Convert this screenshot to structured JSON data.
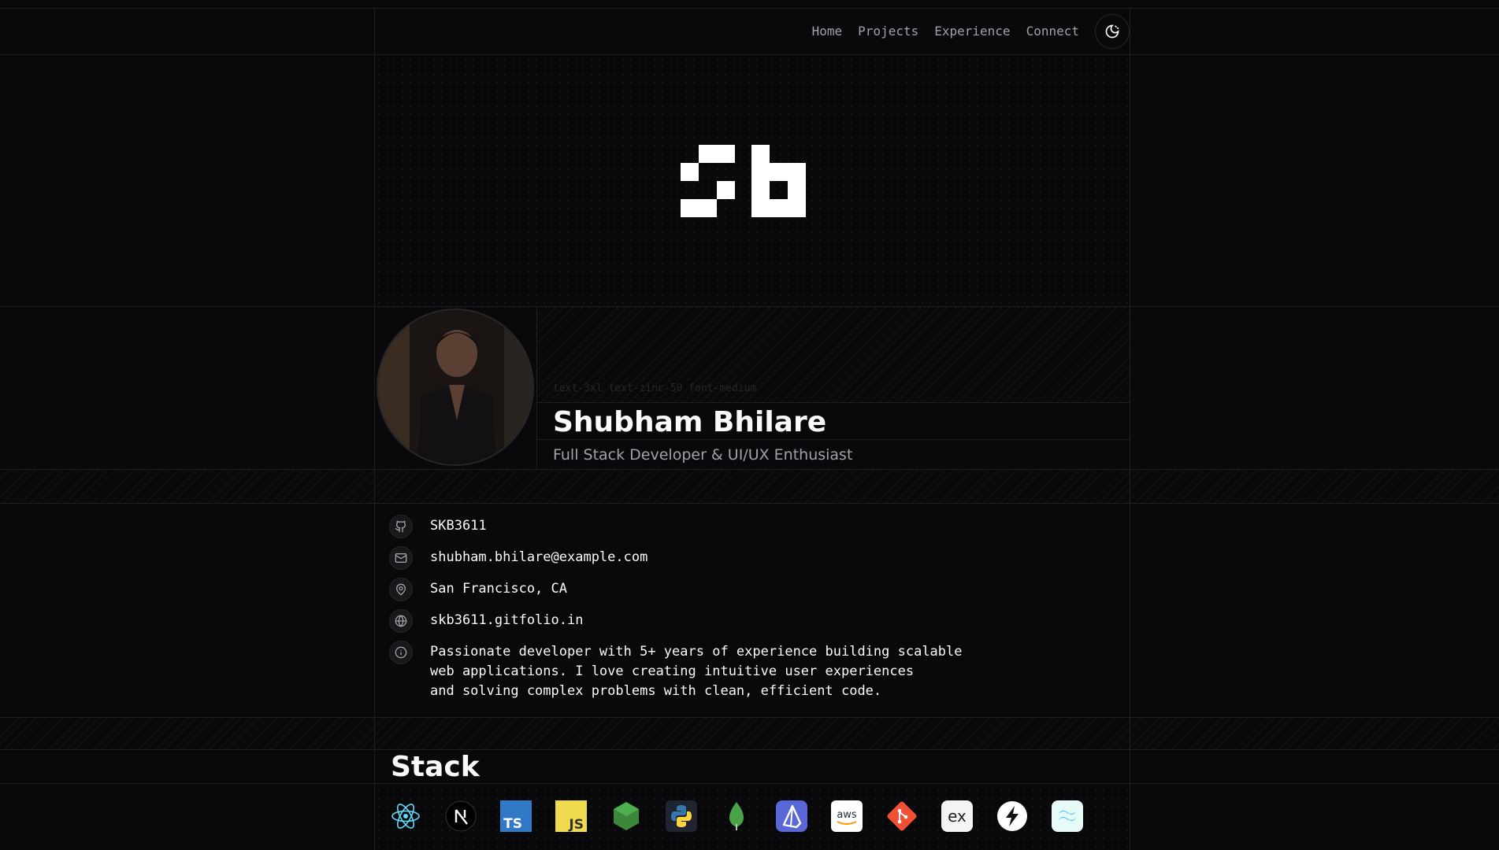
{
  "nav": {
    "links": [
      "Home",
      "Projects",
      "Experience",
      "Connect"
    ],
    "theme_icon": "theme-toggle-icon"
  },
  "profile": {
    "hint": "text-3xl text-zinc-50 font-medium",
    "name": "Shubham Bhilare",
    "role": "Full Stack Developer & UI/UX Enthusiast"
  },
  "info": {
    "github": "SKB3611",
    "email": "shubham.bhilare@example.com",
    "location": "San Francisco, CA",
    "website": "skb3611.gitfolio.in",
    "bio": [
      "Passionate developer with 5+ years of experience building scalable",
      "web applications. I love creating intuitive user experiences",
      "and solving complex problems with clean, efficient code."
    ]
  },
  "stack": {
    "title": "Stack",
    "icons": [
      "react-icon",
      "nextjs-icon",
      "typescript-icon",
      "javascript-icon",
      "nodejs-icon",
      "python-icon",
      "mongodb-icon",
      "prisma-icon",
      "aws-icon",
      "git-icon",
      "express-icon",
      "vercel-icon",
      "tailwind-icon"
    ]
  },
  "colors": {
    "background": "#09090b",
    "text": "#fafafa",
    "muted": "#a1a1aa",
    "border": "#1f1f23"
  }
}
